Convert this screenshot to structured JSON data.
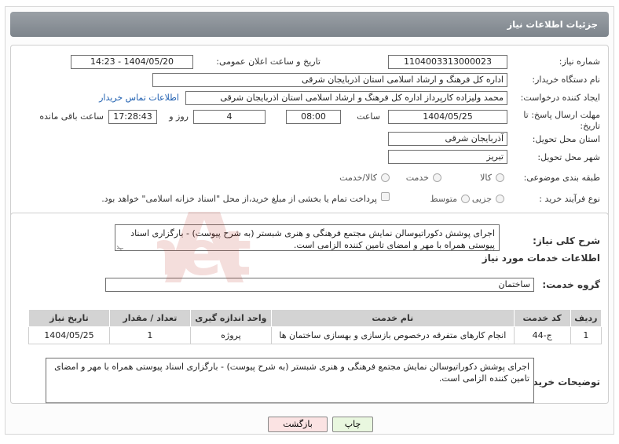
{
  "header": {
    "title": "جزئیات اطلاعات نیاز"
  },
  "form": {
    "need_number_label": "شماره نیاز:",
    "need_number": "1104003313000023",
    "announce_label": "تاریخ و ساعت اعلان عمومی:",
    "announce_value": "1404/05/20 - 14:23",
    "buyer_org_label": "نام دستگاه خریدار:",
    "buyer_org": "اداره کل فرهنگ و ارشاد اسلامی استان اذربایجان شرقی",
    "creator_label": "ایجاد کننده درخواست:",
    "creator": "محمد ولیزاده کارپرداز اداره کل فرهنگ و ارشاد اسلامی استان اذربایجان شرقی",
    "contact_link": "اطلاعات تماس خریدار",
    "deadline_label": "مهلت ارسال پاسخ: تا تاریخ:",
    "deadline_date": "1404/05/25",
    "time_label": "ساعت",
    "deadline_time": "08:00",
    "days_value": "4",
    "days_label": "روز و",
    "remaining_time": "17:28:43",
    "remaining_label": "ساعت باقی مانده",
    "province_label": "استان محل تحویل:",
    "province": "آذربایجان شرقی",
    "city_label": "شهر محل تحویل:",
    "city": "تبریز",
    "category_label": "طبقه بندی موضوعی:",
    "category_options": [
      "کالا",
      "خدمت",
      "کالا/خدمت"
    ],
    "process_label": "نوع فرآیند خرید :",
    "process_options": [
      "جزیی",
      "متوسط"
    ],
    "payment_note": "پرداخت تمام یا بخشی از مبلغ خرید،از محل \"اسناد خزانه اسلامی\" خواهد بود."
  },
  "summary": {
    "label": "شرح کلی نیاز:",
    "text": "اجرای پوشش دکوراتیوسالن نمایش مجتمع فرهنگی و هنری شبستر (به شرح پیوست) - بارگزاری اسناد پیوستی همراه با مهر و امضای تامین کننده الزامی است."
  },
  "services": {
    "heading": "اطلاعات خدمات مورد نیاز",
    "group_label": "گروه خدمت:",
    "group_value": "ساختمان",
    "columns": [
      "ردیف",
      "کد خدمت",
      "نام خدمت",
      "واحد اندازه گیری",
      "تعداد / مقدار",
      "تاریخ نیاز"
    ],
    "rows": [
      [
        "1",
        "ج-44",
        "انجام کارهای متفرقه درخصوص بازسازی و بهسازی ساختمان ها",
        "پروژه",
        "1",
        "1404/05/25"
      ]
    ],
    "buyer_notes_label": "توضیحات خریدار:",
    "buyer_notes": "اجرای پوشش دکوراتیوسالن نمایش مجتمع فرهنگی و هنری شبستر (به شرح پیوست) - بارگزاری اسناد پیوستی همراه با مهر و امضای تامین کننده الزامی است."
  },
  "buttons": {
    "print": "چاپ",
    "back": "بازگشت"
  },
  "watermark": {
    "text": "AriaTender.net"
  },
  "colors": {
    "titlebar": "#8a9097",
    "link": "#1f5fb0",
    "print_bg": "#e9f7df",
    "back_bg": "#fbe3e3"
  }
}
